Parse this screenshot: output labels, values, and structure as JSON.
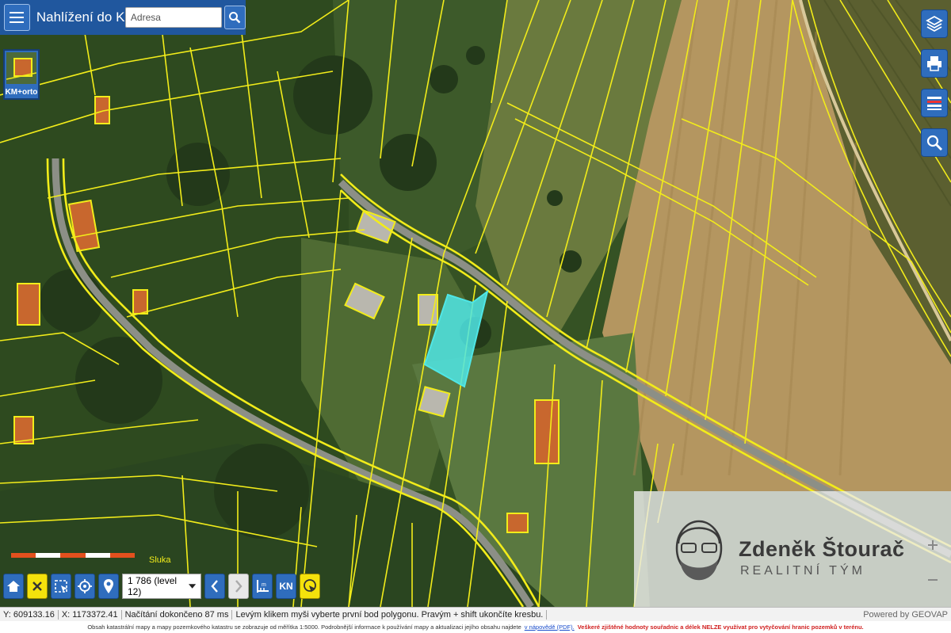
{
  "header": {
    "app_title": "Nahlížení do KN",
    "address_placeholder": "Adresa"
  },
  "layer_switch": {
    "label": "KM+orto"
  },
  "right_tools": [
    "layers-icon",
    "print-icon",
    "legend-icon",
    "search-icon"
  ],
  "toolbar": {
    "level_value": "1 786 (level 12)",
    "kn_label": "KN"
  },
  "map": {
    "street_label": "Sluka",
    "selected_parcel_color": "#4fe6e6",
    "parcel_line_color": "#f2ec1a"
  },
  "watermark": {
    "name": "Zdeněk Štourač",
    "subtitle": "REALITNÍ TÝM"
  },
  "status": {
    "y": "Y: 609133.16",
    "x": "X: 1173372.41",
    "load": "Načítání dokončeno 87 ms",
    "hint": "Levým klikem myši vyberte první bod polygonu. Pravým + shift ukončíte kresbu.",
    "powered": "Powered by GEOVAP"
  },
  "footer": {
    "text1": "Obsah katastrální mapy a mapy pozemkového katastru se zobrazuje od měřítka 1:5000. Podrobnější informace k používání mapy a aktualizaci jejího obsahu najdete",
    "link": "v nápovědě (PDF).",
    "warning": "Veškeré zjištěné hodnoty souřadnic a délek NELZE využívat pro vytyčování hranic pozemků v terénu."
  }
}
